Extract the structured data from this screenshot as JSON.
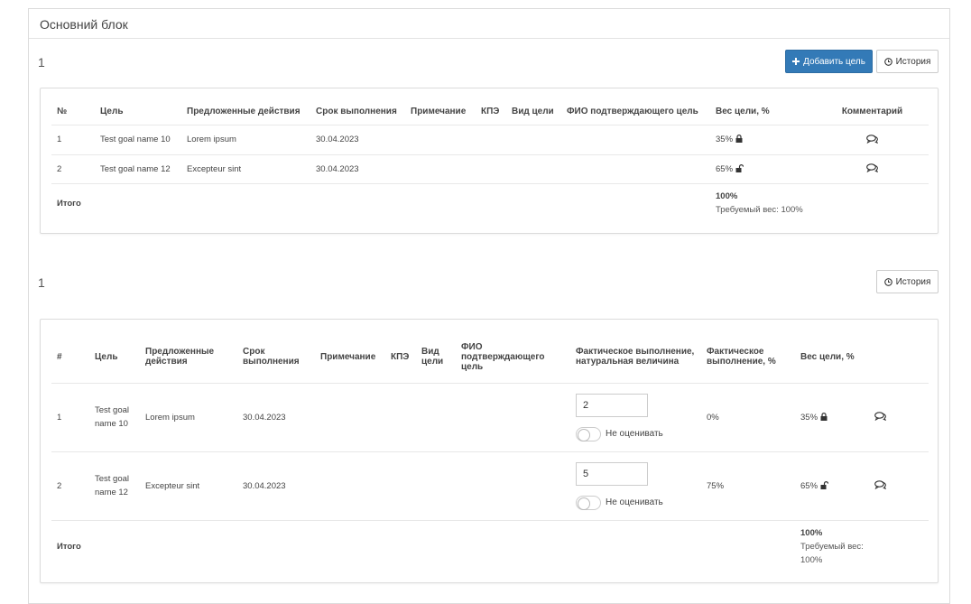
{
  "main_block": {
    "title": "Основний блок",
    "section1": {
      "number": "1",
      "add_goal_label": "Добавить цель",
      "history_label": "История",
      "headers": [
        "№",
        "Цель",
        "Предложенные действия",
        "Срок выполнения",
        "Примечание",
        "КПЭ",
        "Вид цели",
        "ФИО подтверждающего цель",
        "Вес цели, %",
        "Комментарий"
      ],
      "rows": [
        {
          "num": "1",
          "goal": "Test goal name 10",
          "actions": "Lorem ipsum",
          "deadline": "30.04.2023",
          "weight": "35%",
          "lock": "locked"
        },
        {
          "num": "2",
          "goal": "Test goal name 12",
          "actions": "Excepteur sint",
          "deadline": "30.04.2023",
          "weight": "65%",
          "lock": "unlocked"
        }
      ],
      "total_label": "Итого",
      "total_weight": "100%",
      "required_weight": "Требуемый вес: 100%"
    },
    "section2": {
      "number": "1",
      "history_label": "История",
      "headers": {
        "num": "#",
        "goal": "Цель",
        "actions": "Предложенные действия",
        "deadline": "Срок выполнения",
        "note": "Примечание",
        "kpi": "КПЭ",
        "type": "Вид цели",
        "confirmer": "ФИО подтверждающего цель",
        "actual_value": "Фактическое выполнение, натуральная величина",
        "actual_percent": "Фактическое выполнение, %",
        "weight": "Вес цели, %"
      },
      "rows": [
        {
          "num": "1",
          "goal": "Test goal name 10",
          "actions": "Lorem ipsum",
          "deadline": "30.04.2023",
          "actual_value": "2",
          "no_eval_label": "Не оценивать",
          "actual_percent": "0%",
          "weight": "35%",
          "lock": "locked"
        },
        {
          "num": "2",
          "goal": "Test goal name 12",
          "actions": "Excepteur sint",
          "deadline": "30.04.2023",
          "actual_value": "5",
          "no_eval_label": "Не оценивать",
          "actual_percent": "75%",
          "weight": "65%",
          "lock": "unlocked"
        }
      ],
      "total_label": "Итого",
      "total_weight": "100%",
      "required_weight": "Требуемый вес: 100%"
    }
  },
  "icons": {
    "plus": "plus-icon",
    "clock": "clock-icon",
    "lock": "lock-icon",
    "unlock": "unlock-icon",
    "comment": "comments-icon"
  },
  "colors": {
    "primary": "#337ab7",
    "border": "#dcdcdc"
  }
}
